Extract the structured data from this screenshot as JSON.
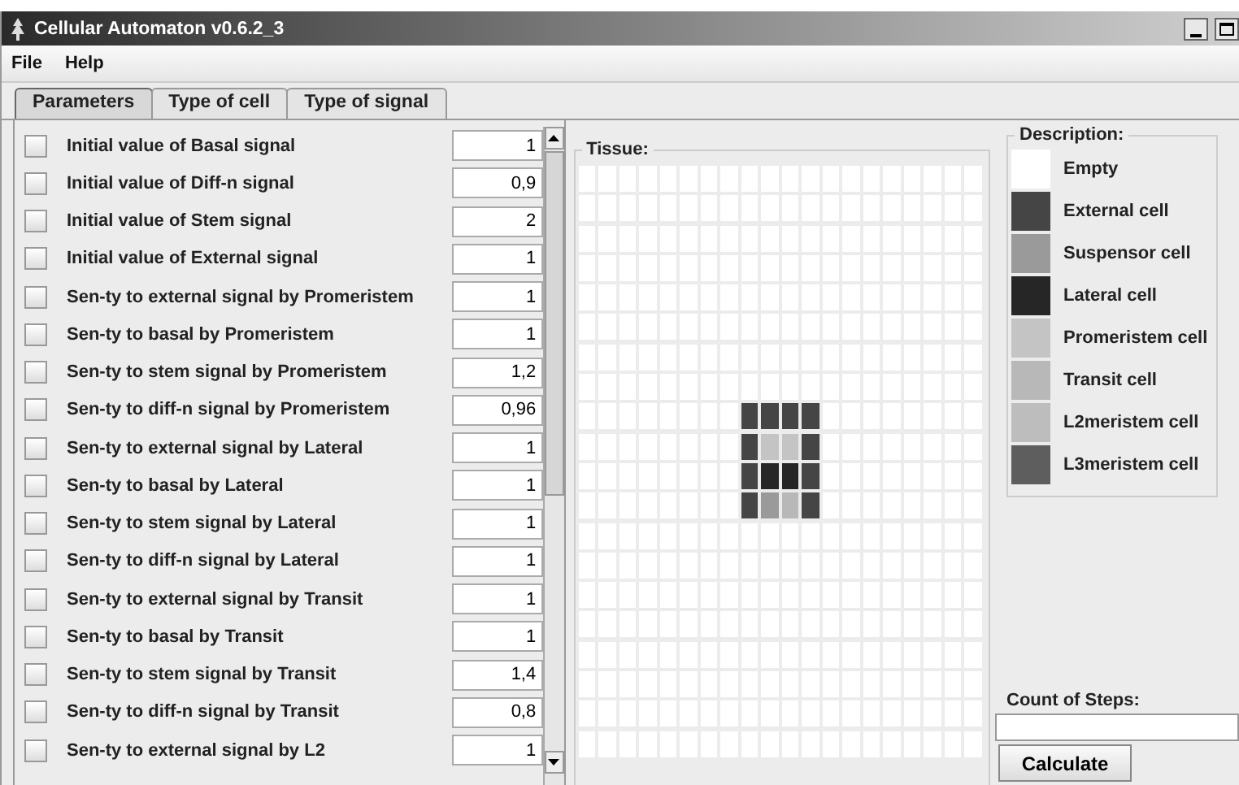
{
  "window": {
    "title": "Cellular Automaton v0.6.2_3"
  },
  "menu": [
    "File",
    "Help"
  ],
  "tabs": [
    {
      "label": "Parameters",
      "selected": true
    },
    {
      "label": "Type of cell",
      "selected": false
    },
    {
      "label": "Type of signal",
      "selected": false
    }
  ],
  "parameters": [
    {
      "label": "Initial value of Basal signal",
      "value": "1",
      "checked": false
    },
    {
      "label": "Initial value of Diff-n signal",
      "value": "0,9",
      "checked": false
    },
    {
      "label": "Initial value of Stem signal",
      "value": "2",
      "checked": false
    },
    {
      "label": "Initial value of External signal",
      "value": "1",
      "checked": false
    },
    {
      "label": "Sen-ty to external signal by Promeristem",
      "value": "1",
      "checked": false
    },
    {
      "label": "Sen-ty to basal by Promeristem",
      "value": "1",
      "checked": false
    },
    {
      "label": "Sen-ty to stem signal by Promeristem",
      "value": "1,2",
      "checked": false
    },
    {
      "label": "Sen-ty to diff-n signal by Promeristem",
      "value": "0,96",
      "checked": false
    },
    {
      "label": "Sen-ty to external signal by Lateral",
      "value": "1",
      "checked": false
    },
    {
      "label": "Sen-ty to basal by Lateral",
      "value": "1",
      "checked": false
    },
    {
      "label": "Sen-ty to stem signal by Lateral",
      "value": "1",
      "checked": false
    },
    {
      "label": "Sen-ty to diff-n signal by Lateral",
      "value": "1",
      "checked": false
    },
    {
      "label": "Sen-ty to external signal by Transit",
      "value": "1",
      "checked": false
    },
    {
      "label": "Sen-ty to basal by Transit",
      "value": "1",
      "checked": false
    },
    {
      "label": "Sen-ty to stem signal by Transit",
      "value": "1,4",
      "checked": false
    },
    {
      "label": "Sen-ty to diff-n signal by Transit",
      "value": "0,8",
      "checked": false
    },
    {
      "label": "Sen-ty to external signal by L2",
      "value": "1",
      "checked": false
    }
  ],
  "tissue": {
    "title": "Tissue:",
    "rows": [
      [
        {
          "kind": "empty"
        },
        {
          "kind": "empty"
        },
        {
          "kind": "empty"
        },
        {
          "kind": "empty"
        },
        {
          "kind": "empty"
        },
        {
          "kind": "empty"
        },
        {
          "kind": "empty"
        },
        {
          "kind": "empty"
        },
        {
          "kind": "empty"
        },
        {
          "kind": "empty"
        },
        {
          "kind": "empty"
        },
        {
          "kind": "empty"
        },
        {
          "kind": "empty"
        },
        {
          "kind": "empty"
        },
        {
          "kind": "empty"
        },
        {
          "kind": "empty"
        },
        {
          "kind": "empty"
        },
        {
          "kind": "empty"
        },
        {
          "kind": "empty"
        },
        {
          "kind": "empty"
        }
      ],
      [
        {
          "kind": "empty"
        },
        {
          "kind": "empty"
        },
        {
          "kind": "empty"
        },
        {
          "kind": "empty"
        },
        {
          "kind": "empty"
        },
        {
          "kind": "empty"
        },
        {
          "kind": "empty"
        },
        {
          "kind": "empty"
        },
        {
          "kind": "empty"
        },
        {
          "kind": "empty"
        },
        {
          "kind": "empty"
        },
        {
          "kind": "empty"
        },
        {
          "kind": "empty"
        },
        {
          "kind": "empty"
        },
        {
          "kind": "empty"
        },
        {
          "kind": "empty"
        },
        {
          "kind": "empty"
        },
        {
          "kind": "empty"
        },
        {
          "kind": "empty"
        },
        {
          "kind": "empty"
        }
      ],
      [
        {
          "kind": "empty"
        },
        {
          "kind": "empty"
        },
        {
          "kind": "empty"
        },
        {
          "kind": "empty"
        },
        {
          "kind": "empty"
        },
        {
          "kind": "empty"
        },
        {
          "kind": "empty"
        },
        {
          "kind": "empty"
        },
        {
          "kind": "empty"
        },
        {
          "kind": "empty"
        },
        {
          "kind": "empty"
        },
        {
          "kind": "empty"
        },
        {
          "kind": "empty"
        },
        {
          "kind": "empty"
        },
        {
          "kind": "empty"
        },
        {
          "kind": "empty"
        },
        {
          "kind": "empty"
        },
        {
          "kind": "empty"
        },
        {
          "kind": "empty"
        },
        {
          "kind": "empty"
        }
      ],
      [
        {
          "kind": "empty"
        },
        {
          "kind": "empty"
        },
        {
          "kind": "empty"
        },
        {
          "kind": "empty"
        },
        {
          "kind": "empty"
        },
        {
          "kind": "empty"
        },
        {
          "kind": "empty"
        },
        {
          "kind": "empty"
        },
        {
          "kind": "empty"
        },
        {
          "kind": "empty"
        },
        {
          "kind": "empty"
        },
        {
          "kind": "empty"
        },
        {
          "kind": "empty"
        },
        {
          "kind": "empty"
        },
        {
          "kind": "empty"
        },
        {
          "kind": "empty"
        },
        {
          "kind": "empty"
        },
        {
          "kind": "empty"
        },
        {
          "kind": "empty"
        },
        {
          "kind": "empty"
        }
      ],
      [
        {
          "kind": "empty"
        },
        {
          "kind": "empty"
        },
        {
          "kind": "empty"
        },
        {
          "kind": "empty"
        },
        {
          "kind": "empty"
        },
        {
          "kind": "empty"
        },
        {
          "kind": "empty"
        },
        {
          "kind": "empty"
        },
        {
          "kind": "empty"
        },
        {
          "kind": "empty"
        },
        {
          "kind": "empty"
        },
        {
          "kind": "empty"
        },
        {
          "kind": "empty"
        },
        {
          "kind": "empty"
        },
        {
          "kind": "empty"
        },
        {
          "kind": "empty"
        },
        {
          "kind": "empty"
        },
        {
          "kind": "empty"
        },
        {
          "kind": "empty"
        },
        {
          "kind": "empty"
        }
      ],
      [
        {
          "kind": "empty"
        },
        {
          "kind": "empty"
        },
        {
          "kind": "empty"
        },
        {
          "kind": "empty"
        },
        {
          "kind": "empty"
        },
        {
          "kind": "empty"
        },
        {
          "kind": "empty"
        },
        {
          "kind": "empty"
        },
        {
          "kind": "empty"
        },
        {
          "kind": "empty"
        },
        {
          "kind": "empty"
        },
        {
          "kind": "empty"
        },
        {
          "kind": "empty"
        },
        {
          "kind": "empty"
        },
        {
          "kind": "empty"
        },
        {
          "kind": "empty"
        },
        {
          "kind": "empty"
        },
        {
          "kind": "empty"
        },
        {
          "kind": "empty"
        },
        {
          "kind": "empty"
        }
      ],
      [
        {
          "kind": "empty"
        },
        {
          "kind": "empty"
        },
        {
          "kind": "empty"
        },
        {
          "kind": "empty"
        },
        {
          "kind": "empty"
        },
        {
          "kind": "empty"
        },
        {
          "kind": "empty"
        },
        {
          "kind": "empty"
        },
        {
          "kind": "empty"
        },
        {
          "kind": "empty"
        },
        {
          "kind": "empty"
        },
        {
          "kind": "empty"
        },
        {
          "kind": "empty"
        },
        {
          "kind": "empty"
        },
        {
          "kind": "empty"
        },
        {
          "kind": "empty"
        },
        {
          "kind": "empty"
        },
        {
          "kind": "empty"
        },
        {
          "kind": "empty"
        },
        {
          "kind": "empty"
        }
      ],
      [
        {
          "kind": "empty"
        },
        {
          "kind": "empty"
        },
        {
          "kind": "empty"
        },
        {
          "kind": "empty"
        },
        {
          "kind": "empty"
        },
        {
          "kind": "empty"
        },
        {
          "kind": "empty"
        },
        {
          "kind": "empty"
        },
        {
          "kind": "empty"
        },
        {
          "kind": "empty"
        },
        {
          "kind": "empty"
        },
        {
          "kind": "empty"
        },
        {
          "kind": "empty"
        },
        {
          "kind": "empty"
        },
        {
          "kind": "empty"
        },
        {
          "kind": "empty"
        },
        {
          "kind": "empty"
        },
        {
          "kind": "empty"
        },
        {
          "kind": "empty"
        },
        {
          "kind": "empty"
        }
      ],
      [
        {
          "kind": "empty"
        },
        {
          "kind": "empty"
        },
        {
          "kind": "empty"
        },
        {
          "kind": "empty"
        },
        {
          "kind": "empty"
        },
        {
          "kind": "empty"
        },
        {
          "kind": "empty"
        },
        {
          "kind": "empty"
        },
        {
          "kind": "external"
        },
        {
          "kind": "external"
        },
        {
          "kind": "external"
        },
        {
          "kind": "external"
        },
        {
          "kind": "empty"
        },
        {
          "kind": "empty"
        },
        {
          "kind": "empty"
        },
        {
          "kind": "empty"
        },
        {
          "kind": "empty"
        },
        {
          "kind": "empty"
        },
        {
          "kind": "empty"
        },
        {
          "kind": "empty"
        }
      ],
      [
        {
          "kind": "empty"
        },
        {
          "kind": "empty"
        },
        {
          "kind": "empty"
        },
        {
          "kind": "empty"
        },
        {
          "kind": "empty"
        },
        {
          "kind": "empty"
        },
        {
          "kind": "empty"
        },
        {
          "kind": "empty"
        },
        {
          "kind": "external"
        },
        {
          "kind": "promeristem"
        },
        {
          "kind": "promeristem"
        },
        {
          "kind": "external"
        },
        {
          "kind": "empty"
        },
        {
          "kind": "empty"
        },
        {
          "kind": "empty"
        },
        {
          "kind": "empty"
        },
        {
          "kind": "empty"
        },
        {
          "kind": "empty"
        },
        {
          "kind": "empty"
        },
        {
          "kind": "empty"
        }
      ],
      [
        {
          "kind": "empty"
        },
        {
          "kind": "empty"
        },
        {
          "kind": "empty"
        },
        {
          "kind": "empty"
        },
        {
          "kind": "empty"
        },
        {
          "kind": "empty"
        },
        {
          "kind": "empty"
        },
        {
          "kind": "empty"
        },
        {
          "kind": "external"
        },
        {
          "kind": "lateral"
        },
        {
          "kind": "lateral"
        },
        {
          "kind": "external"
        },
        {
          "kind": "empty"
        },
        {
          "kind": "empty"
        },
        {
          "kind": "empty"
        },
        {
          "kind": "empty"
        },
        {
          "kind": "empty"
        },
        {
          "kind": "empty"
        },
        {
          "kind": "empty"
        },
        {
          "kind": "empty"
        }
      ],
      [
        {
          "kind": "empty"
        },
        {
          "kind": "empty"
        },
        {
          "kind": "empty"
        },
        {
          "kind": "empty"
        },
        {
          "kind": "empty"
        },
        {
          "kind": "empty"
        },
        {
          "kind": "empty"
        },
        {
          "kind": "empty"
        },
        {
          "kind": "external"
        },
        {
          "kind": "suspensor"
        },
        {
          "kind": "transit"
        },
        {
          "kind": "external"
        },
        {
          "kind": "empty"
        },
        {
          "kind": "empty"
        },
        {
          "kind": "empty"
        },
        {
          "kind": "empty"
        },
        {
          "kind": "empty"
        },
        {
          "kind": "empty"
        },
        {
          "kind": "empty"
        },
        {
          "kind": "empty"
        }
      ],
      [
        {
          "kind": "empty"
        },
        {
          "kind": "empty"
        },
        {
          "kind": "empty"
        },
        {
          "kind": "empty"
        },
        {
          "kind": "empty"
        },
        {
          "kind": "empty"
        },
        {
          "kind": "empty"
        },
        {
          "kind": "empty"
        },
        {
          "kind": "empty"
        },
        {
          "kind": "empty"
        },
        {
          "kind": "empty"
        },
        {
          "kind": "empty"
        },
        {
          "kind": "empty"
        },
        {
          "kind": "empty"
        },
        {
          "kind": "empty"
        },
        {
          "kind": "empty"
        },
        {
          "kind": "empty"
        },
        {
          "kind": "empty"
        },
        {
          "kind": "empty"
        },
        {
          "kind": "empty"
        }
      ],
      [
        {
          "kind": "empty"
        },
        {
          "kind": "empty"
        },
        {
          "kind": "empty"
        },
        {
          "kind": "empty"
        },
        {
          "kind": "empty"
        },
        {
          "kind": "empty"
        },
        {
          "kind": "empty"
        },
        {
          "kind": "empty"
        },
        {
          "kind": "empty"
        },
        {
          "kind": "empty"
        },
        {
          "kind": "empty"
        },
        {
          "kind": "empty"
        },
        {
          "kind": "empty"
        },
        {
          "kind": "empty"
        },
        {
          "kind": "empty"
        },
        {
          "kind": "empty"
        },
        {
          "kind": "empty"
        },
        {
          "kind": "empty"
        },
        {
          "kind": "empty"
        },
        {
          "kind": "empty"
        }
      ],
      [
        {
          "kind": "empty"
        },
        {
          "kind": "empty"
        },
        {
          "kind": "empty"
        },
        {
          "kind": "empty"
        },
        {
          "kind": "empty"
        },
        {
          "kind": "empty"
        },
        {
          "kind": "empty"
        },
        {
          "kind": "empty"
        },
        {
          "kind": "empty"
        },
        {
          "kind": "empty"
        },
        {
          "kind": "empty"
        },
        {
          "kind": "empty"
        },
        {
          "kind": "empty"
        },
        {
          "kind": "empty"
        },
        {
          "kind": "empty"
        },
        {
          "kind": "empty"
        },
        {
          "kind": "empty"
        },
        {
          "kind": "empty"
        },
        {
          "kind": "empty"
        },
        {
          "kind": "empty"
        }
      ],
      [
        {
          "kind": "empty"
        },
        {
          "kind": "empty"
        },
        {
          "kind": "empty"
        },
        {
          "kind": "empty"
        },
        {
          "kind": "empty"
        },
        {
          "kind": "empty"
        },
        {
          "kind": "empty"
        },
        {
          "kind": "empty"
        },
        {
          "kind": "empty"
        },
        {
          "kind": "empty"
        },
        {
          "kind": "empty"
        },
        {
          "kind": "empty"
        },
        {
          "kind": "empty"
        },
        {
          "kind": "empty"
        },
        {
          "kind": "empty"
        },
        {
          "kind": "empty"
        },
        {
          "kind": "empty"
        },
        {
          "kind": "empty"
        },
        {
          "kind": "empty"
        },
        {
          "kind": "empty"
        }
      ],
      [
        {
          "kind": "empty"
        },
        {
          "kind": "empty"
        },
        {
          "kind": "empty"
        },
        {
          "kind": "empty"
        },
        {
          "kind": "empty"
        },
        {
          "kind": "empty"
        },
        {
          "kind": "empty"
        },
        {
          "kind": "empty"
        },
        {
          "kind": "empty"
        },
        {
          "kind": "empty"
        },
        {
          "kind": "empty"
        },
        {
          "kind": "empty"
        },
        {
          "kind": "empty"
        },
        {
          "kind": "empty"
        },
        {
          "kind": "empty"
        },
        {
          "kind": "empty"
        },
        {
          "kind": "empty"
        },
        {
          "kind": "empty"
        },
        {
          "kind": "empty"
        },
        {
          "kind": "empty"
        }
      ],
      [
        {
          "kind": "empty"
        },
        {
          "kind": "empty"
        },
        {
          "kind": "empty"
        },
        {
          "kind": "empty"
        },
        {
          "kind": "empty"
        },
        {
          "kind": "empty"
        },
        {
          "kind": "empty"
        },
        {
          "kind": "empty"
        },
        {
          "kind": "empty"
        },
        {
          "kind": "empty"
        },
        {
          "kind": "empty"
        },
        {
          "kind": "empty"
        },
        {
          "kind": "empty"
        },
        {
          "kind": "empty"
        },
        {
          "kind": "empty"
        },
        {
          "kind": "empty"
        },
        {
          "kind": "empty"
        },
        {
          "kind": "empty"
        },
        {
          "kind": "empty"
        },
        {
          "kind": "empty"
        }
      ],
      [
        {
          "kind": "empty"
        },
        {
          "kind": "empty"
        },
        {
          "kind": "empty"
        },
        {
          "kind": "empty"
        },
        {
          "kind": "empty"
        },
        {
          "kind": "empty"
        },
        {
          "kind": "empty"
        },
        {
          "kind": "empty"
        },
        {
          "kind": "empty"
        },
        {
          "kind": "empty"
        },
        {
          "kind": "empty"
        },
        {
          "kind": "empty"
        },
        {
          "kind": "empty"
        },
        {
          "kind": "empty"
        },
        {
          "kind": "empty"
        },
        {
          "kind": "empty"
        },
        {
          "kind": "empty"
        },
        {
          "kind": "empty"
        },
        {
          "kind": "empty"
        },
        {
          "kind": "empty"
        }
      ],
      [
        {
          "kind": "empty"
        },
        {
          "kind": "empty"
        },
        {
          "kind": "empty"
        },
        {
          "kind": "empty"
        },
        {
          "kind": "empty"
        },
        {
          "kind": "empty"
        },
        {
          "kind": "empty"
        },
        {
          "kind": "empty"
        },
        {
          "kind": "empty"
        },
        {
          "kind": "empty"
        },
        {
          "kind": "empty"
        },
        {
          "kind": "empty"
        },
        {
          "kind": "empty"
        },
        {
          "kind": "empty"
        },
        {
          "kind": "empty"
        },
        {
          "kind": "empty"
        },
        {
          "kind": "empty"
        },
        {
          "kind": "empty"
        },
        {
          "kind": "empty"
        },
        {
          "kind": "empty"
        }
      ]
    ]
  },
  "description": {
    "title": "Description:",
    "items": [
      {
        "label": "Empty",
        "color": "#ffffff"
      },
      {
        "label": "External cell",
        "color": "#454545"
      },
      {
        "label": "Suspensor cell",
        "color": "#9a9a9a"
      },
      {
        "label": "Lateral cell",
        "color": "#262626"
      },
      {
        "label": "Promeristem cell",
        "color": "#c4c4c4"
      },
      {
        "label": "Transit cell",
        "color": "#b8b8b8"
      },
      {
        "label": "L2meristem cell",
        "color": "#bdbdbd"
      },
      {
        "label": "L3meristem cell",
        "color": "#5e5e5e"
      }
    ]
  },
  "steps": {
    "label": "Count of Steps:"
  },
  "calculate": {
    "label": "Calculate"
  }
}
